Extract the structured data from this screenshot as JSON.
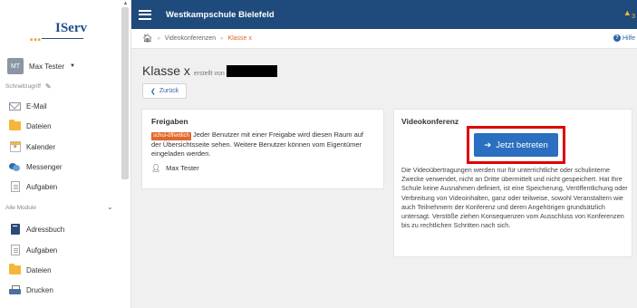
{
  "sidebar": {
    "logo_text": "IServ",
    "user": {
      "initials": "MT",
      "name": "Max Tester"
    },
    "quick_access_label": "Schnellzugriff",
    "quick_items": [
      {
        "label": "E-Mail",
        "icon": "mail-icon"
      },
      {
        "label": "Dateien",
        "icon": "folder-icon"
      },
      {
        "label": "Kalender",
        "icon": "calendar-icon",
        "day": "9"
      },
      {
        "label": "Messenger",
        "icon": "messenger-icon"
      },
      {
        "label": "Aufgaben",
        "icon": "tasks-icon"
      }
    ],
    "all_modules_label": "Alle Module",
    "module_items": [
      {
        "label": "Adressbuch",
        "icon": "addressbook-icon"
      },
      {
        "label": "Aufgaben",
        "icon": "tasks-icon"
      },
      {
        "label": "Dateien",
        "icon": "folder-icon"
      },
      {
        "label": "Drucken",
        "icon": "printer-icon"
      }
    ]
  },
  "topbar": {
    "title": "Westkampschule Bielefeld",
    "notification_count": "3"
  },
  "breadcrumb": {
    "items": [
      "Videokonferenzen",
      "Klasse x"
    ],
    "help": "Hilfe"
  },
  "page": {
    "title": "Klasse x",
    "created_by": "erstellt von",
    "back_label": "Zurück"
  },
  "shares": {
    "heading": "Freigaben",
    "badge": "schul-öffentlich",
    "text": " Jeder Benutzer mit einer Freigabe wird diesen Raum auf der Übersichtsseite sehen. Weitere Benutzer können vom Eigentümer eingeladen werden.",
    "owner": "Max Tester"
  },
  "conference": {
    "heading": "Videokonferenz",
    "join_label": "Jetzt betreten",
    "info": "Die Videoübertragungen werden nur für unterrichtliche oder schulinterne Zwecke verwendet, nicht an Dritte übermittelt und nicht gespeichert. Hat Ihre Schule keine Ausnahmen definiert, ist eine Speicherung, Veröffentlichung oder Verbreitung von Videoinhalten, ganz oder teilweise, sowohl Veranstaltern wie auch Teilnehmern der Konferenz und deren Angehörigen grundsätzlich untersagt. Verstöße ziehen Konsequenzen vom Ausschluss von Konferenzen bis zu rechtlichen Schritten nach sich."
  },
  "colors": {
    "topbar": "#1f4a7c",
    "accent": "#e2672b",
    "button": "#2a6fc0",
    "highlight": "#e00000"
  }
}
